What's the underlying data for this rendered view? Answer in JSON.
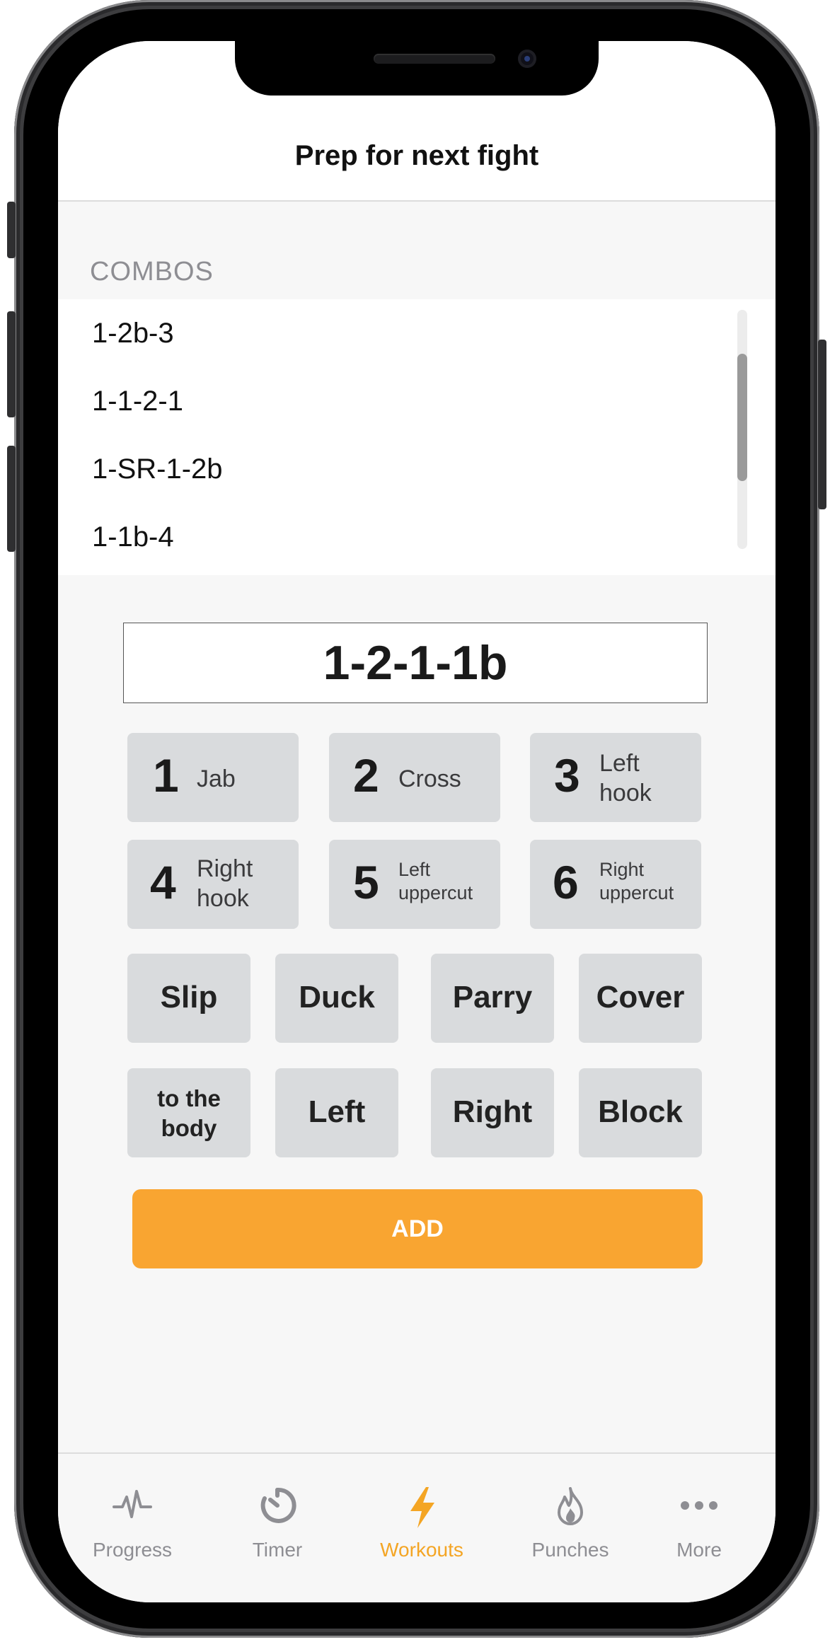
{
  "nav": {
    "title": "Prep for next fight"
  },
  "combos": {
    "header": "COMBOS",
    "items": [
      "1-2b-3",
      "1-1-2-1",
      "1-SR-1-2b",
      "1-1b-4"
    ]
  },
  "combo_input": {
    "value": "1-2-1-1b"
  },
  "punch_keys": [
    {
      "num": "1",
      "label": "Jab"
    },
    {
      "num": "2",
      "label": "Cross"
    },
    {
      "num": "3",
      "label": "Left hook"
    },
    {
      "num": "4",
      "label": "Right hook"
    },
    {
      "num": "5",
      "label": "Left uppercut"
    },
    {
      "num": "6",
      "label": "Right uppercut"
    }
  ],
  "defense_keys": [
    "Slip",
    "Duck",
    "Parry",
    "Cover"
  ],
  "modifier_keys": [
    "to the body",
    "Left",
    "Right",
    "Block"
  ],
  "add_button": {
    "label": "ADD"
  },
  "tabs": [
    {
      "label": "Progress",
      "icon": "pulse-icon"
    },
    {
      "label": "Timer",
      "icon": "timer-icon"
    },
    {
      "label": "Workouts",
      "icon": "lightning-icon",
      "active": true
    },
    {
      "label": "Punches",
      "icon": "flame-icon"
    },
    {
      "label": "More",
      "icon": "ellipsis-icon"
    }
  ],
  "colors": {
    "accent": "#f9a531",
    "active_tab": "#f4a524",
    "key_bg": "#d9dbdd",
    "inactive_tab": "#8e8e93"
  }
}
